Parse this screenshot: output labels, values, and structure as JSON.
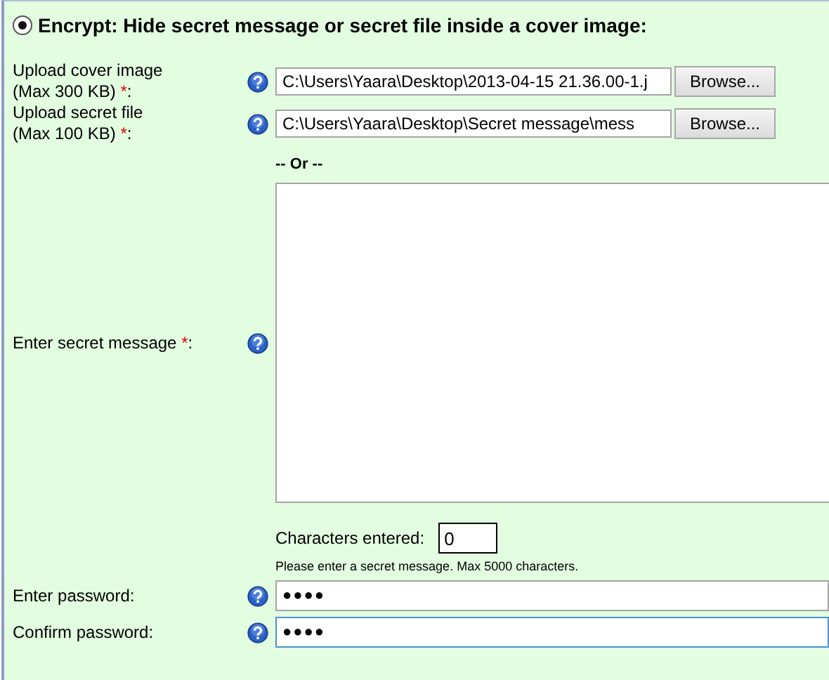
{
  "header": {
    "radio_selected": true,
    "title": "Encrypt: Hide secret message or secret file inside a cover image:"
  },
  "file_rows": [
    {
      "label_lines": [
        "Upload cover image",
        "(Max 300 KB) "
      ],
      "required_mark": "*",
      "label_end": ":",
      "value": "C:\\Users\\Yaara\\Desktop\\2013-04-15 21.36.00-1.j",
      "button": "Browse..."
    },
    {
      "label_lines": [
        "Upload secret file",
        "(Max 100 KB) "
      ],
      "required_mark": "*",
      "label_end": ":",
      "value": "C:\\Users\\Yaara\\Desktop\\Secret message\\mess",
      "button": "Browse..."
    }
  ],
  "or_text": "-- Or --",
  "message": {
    "label": "Enter secret message ",
    "required_mark": "*",
    "label_end": ":",
    "counter_label": "Characters entered:",
    "counter_value": "0",
    "hint": "Please enter a secret message. Max 5000 characters."
  },
  "password_rows": [
    {
      "label": "Enter password:",
      "value": "●●●●",
      "focused": false
    },
    {
      "label": "Confirm password:",
      "value": "●●●●",
      "focused": true
    }
  ]
}
